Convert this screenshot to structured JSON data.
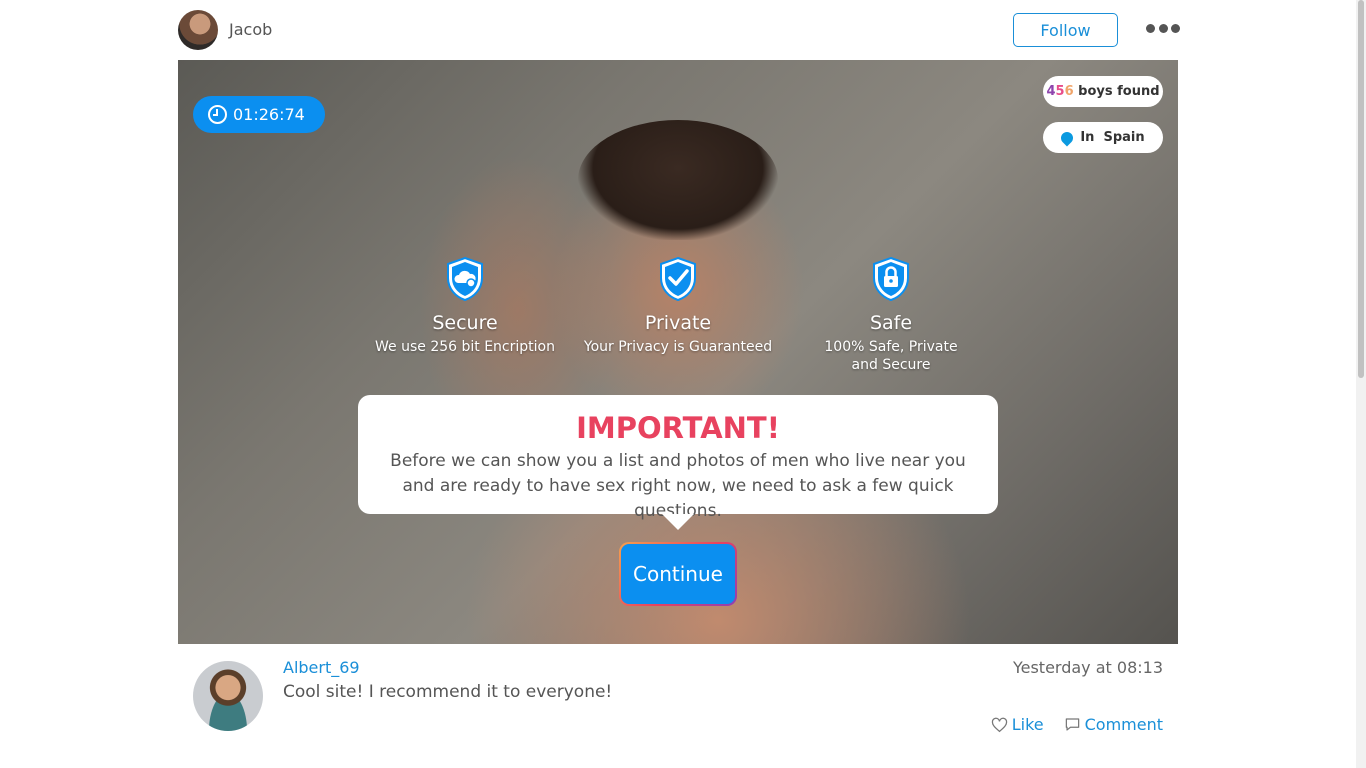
{
  "header": {
    "username": "Jacob",
    "follow_label": "Follow"
  },
  "hero": {
    "timer": "01:26:74",
    "found": {
      "d1": "4",
      "d2": "5",
      "d3": "6",
      "label": " boys found"
    },
    "location": "In  Spain",
    "features": [
      {
        "title": "Secure",
        "desc": "We use 256 bit Encription",
        "icon": "cloud-shield-icon"
      },
      {
        "title": "Private",
        "desc": "Your Privacy is Guaranteed",
        "icon": "check-shield-icon"
      },
      {
        "title": "Safe",
        "desc": "100% Safe, Private and Secure",
        "icon": "lock-shield-icon"
      }
    ],
    "card": {
      "heading": "IMPORTANT!",
      "message": "Before we can show you a list and photos of men who live near you and are ready to have sex right now, we need to ask a few quick questions."
    },
    "continue_label": "Continue"
  },
  "comment": {
    "author": "Albert_69",
    "time": "Yesterday at 08:13",
    "text": "Cool site! I recommend it to everyone!",
    "like_label": "Like",
    "comment_label": "Comment"
  },
  "colors": {
    "accent": "#0b8ff0",
    "link": "#1a8fd8",
    "important": "#e8425f"
  }
}
